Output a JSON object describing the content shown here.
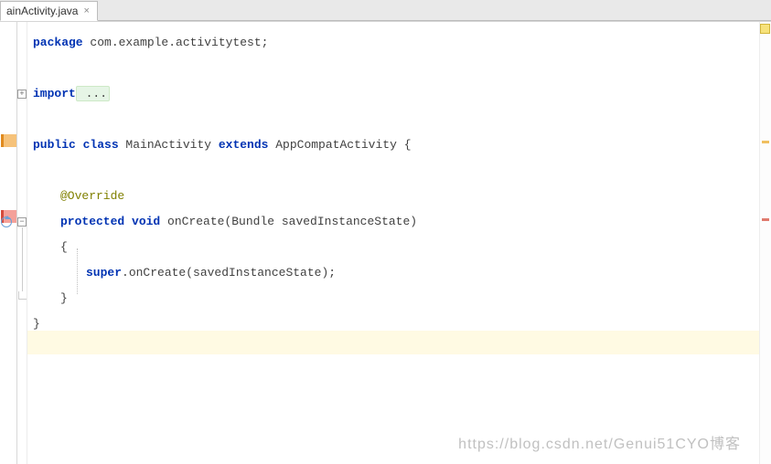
{
  "tab": {
    "label": "ainActivity.java",
    "close_glyph": "×"
  },
  "code": {
    "kw_package": "package",
    "package_name": " com.example.activitytest",
    "semicolon": ";",
    "kw_import": "import",
    "import_folded": " ...",
    "kw_public": "public",
    "kw_class": " class",
    "class_name": " MainActivity ",
    "kw_extends": "extends",
    "super_class": " AppCompatActivity ",
    "brace_open": "{",
    "annotation_override": "@Override",
    "kw_protected": "protected",
    "kw_void": " void",
    "method_sig": " onCreate(Bundle savedInstanceState)",
    "kw_super": "super",
    "super_call": ".onCreate(savedInstanceState)",
    "brace_close": "}"
  },
  "fold": {
    "plus": "+",
    "minus": "−"
  },
  "watermark": "https://blog.csdn.net/Genui51CYO博客"
}
